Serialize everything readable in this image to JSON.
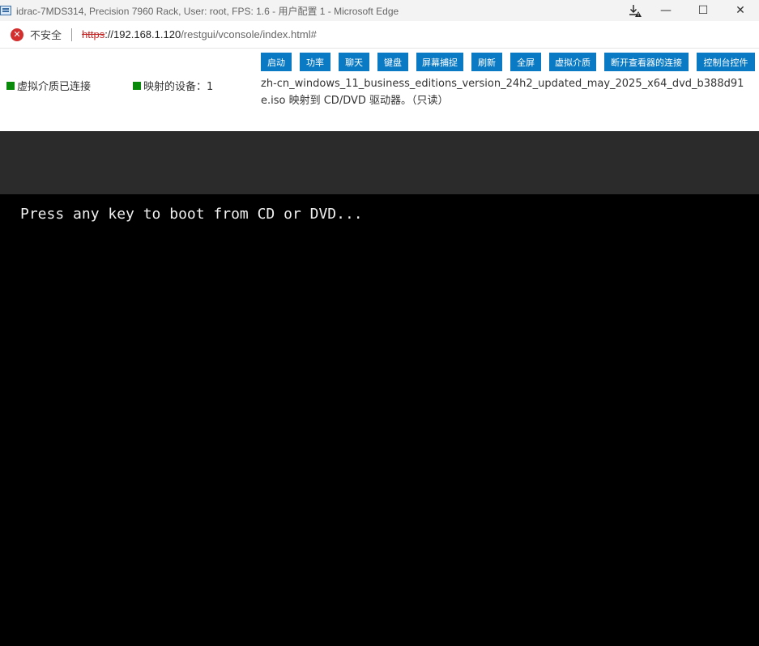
{
  "titlebar": {
    "title": "idrac-7MDS314, Precision 7960 Rack, User: root, FPS: 1.6 - 用户配置 1 - Microsoft Edge",
    "minimize": "—",
    "maximize": "☐",
    "close": "✕"
  },
  "addressbar": {
    "security_label": "不安全",
    "url_scheme": "https",
    "url_sep": "://",
    "url_host": "192.168.1.120",
    "url_path": "/restgui/vconsole/index.html#"
  },
  "toolbar": {
    "buttons": [
      "启动",
      "功率",
      "聊天",
      "键盘",
      "屏幕捕捉",
      "刷新",
      "全屏",
      "虚拟介质",
      "断开查看器的连接",
      "控制台控件"
    ],
    "status_media": "虚拟介质已连接",
    "status_devices": "映射的设备：1",
    "mapped_text": "zh-cn_windows_11_business_editions_version_24h2_updated_may_2025_x64_dvd_b388d91e.iso 映射到 CD/DVD 驱动器。（只读）",
    "accent_color": "#0a7ac4",
    "status_color": "#0a8a0a"
  },
  "console": {
    "boot_message": "Press any key to boot from CD or DVD..."
  }
}
